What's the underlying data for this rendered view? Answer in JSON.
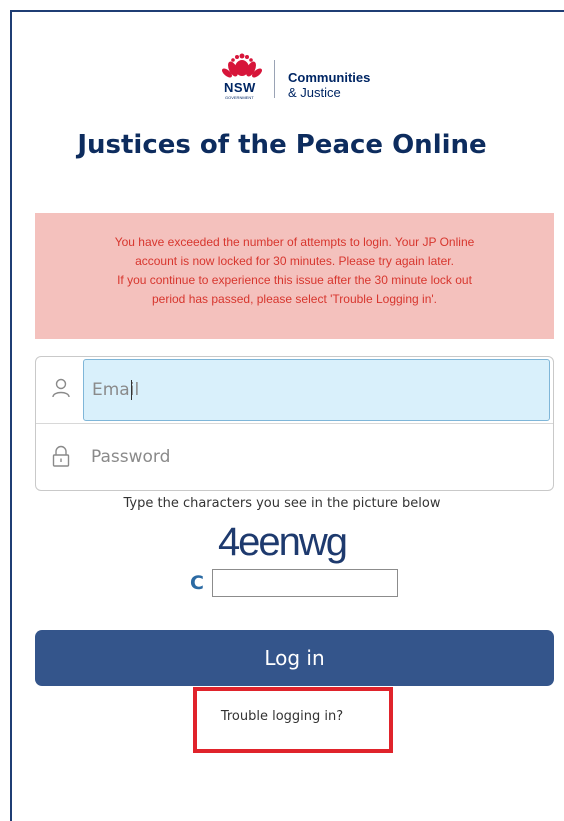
{
  "logo": {
    "brand": "NSW",
    "brand_sub": "GOVERNMENT",
    "department_line1": "Communities",
    "department_line2": "& Justice"
  },
  "page": {
    "title": "Justices of the Peace Online"
  },
  "alert": {
    "lines": [
      "You have exceeded the number of attempts to login. Your JP Online",
      "account is now locked for 30 minutes. Please try again later.",
      "If you continue to experience this issue after the 30 minute lock out",
      "period has passed, please select 'Trouble Logging in'."
    ]
  },
  "form": {
    "email_placeholder": "Email",
    "email_value": "",
    "password_placeholder": "Password",
    "password_value": ""
  },
  "captcha": {
    "instruction": "Type the characters you see in the picture below",
    "image_text": "4eenwg",
    "refresh_symbol": "C",
    "input_value": ""
  },
  "actions": {
    "login_label": "Log in",
    "trouble_label": "Trouble logging in?"
  },
  "colors": {
    "title": "#0d2c5e",
    "alert_bg": "#f4c1bd",
    "alert_text": "#d7362e",
    "login_button": "#34558b",
    "highlight_box": "#e0232b"
  }
}
